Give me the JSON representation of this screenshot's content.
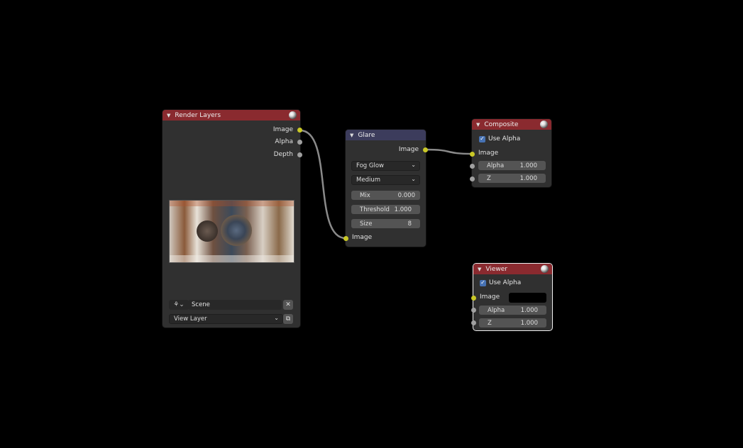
{
  "render_layers": {
    "title": "Render Layers",
    "outputs": [
      "Image",
      "Alpha",
      "Depth"
    ],
    "scene_value": "Scene",
    "view_layer_value": "View Layer"
  },
  "glare": {
    "title": "Glare",
    "output_label": "Image",
    "type_value": "Fog Glow",
    "quality_value": "Medium",
    "mix_label": "Mix",
    "mix_value": "0.000",
    "threshold_label": "Threshold",
    "threshold_value": "1.000",
    "size_label": "Size",
    "size_value": "8",
    "input_label": "Image"
  },
  "composite": {
    "title": "Composite",
    "use_alpha_label": "Use Alpha",
    "use_alpha_checked": true,
    "image_label": "Image",
    "alpha_label": "Alpha",
    "alpha_value": "1.000",
    "z_label": "Z",
    "z_value": "1.000"
  },
  "viewer": {
    "title": "Viewer",
    "use_alpha_label": "Use Alpha",
    "use_alpha_checked": true,
    "image_label": "Image",
    "alpha_label": "Alpha",
    "alpha_value": "1.000",
    "z_label": "Z",
    "z_value": "1.000"
  },
  "colors": {
    "background": "#000000",
    "node_body": "#303030",
    "output_header": "#8a2a2f",
    "filter_header": "#3c3c5c",
    "socket_color": "#c9c826",
    "socket_value": "#a0a0a0",
    "checkbox": "#4772b3"
  }
}
